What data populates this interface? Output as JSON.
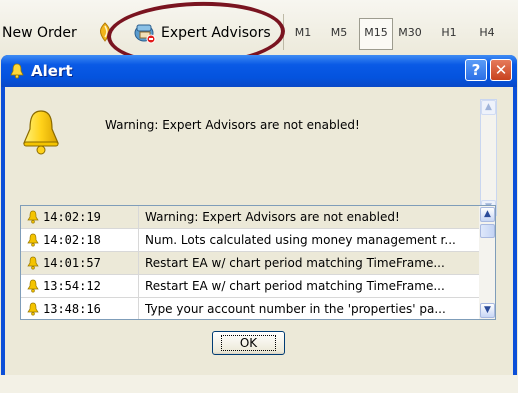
{
  "toolbar": {
    "new_order_label": "New Order",
    "expert_advisors_label": "Expert Advisors",
    "timeframes": [
      "M1",
      "M5",
      "M15",
      "M30",
      "H1",
      "H4"
    ],
    "active_timeframe": "M15"
  },
  "dialog": {
    "title": "Alert",
    "help_label": "?",
    "close_label": "✕",
    "message": "Warning: Expert Advisors are not enabled!",
    "ok_label": "OK"
  },
  "log": [
    {
      "time": "14:02:19",
      "message": "Warning: Expert Advisors are not enabled!"
    },
    {
      "time": "14:02:18",
      "message": "Num. Lots calculated using money management r..."
    },
    {
      "time": "14:01:57",
      "message": "Restart EA w/ chart period matching TimeFrame..."
    },
    {
      "time": "13:54:12",
      "message": "Restart EA w/ chart period matching TimeFrame..."
    },
    {
      "time": "13:48:16",
      "message": "Type your account number in the 'properties' pa..."
    }
  ],
  "colors": {
    "titlebar": "#0a5ae6",
    "annotation_circle": "#7a1420",
    "bell": "#f5c400"
  },
  "icons": {
    "new_order": "new-order-icon",
    "expert_advisors": "expert-advisors-icon",
    "alert": "bell-icon",
    "help": "help-icon",
    "close": "close-icon"
  }
}
